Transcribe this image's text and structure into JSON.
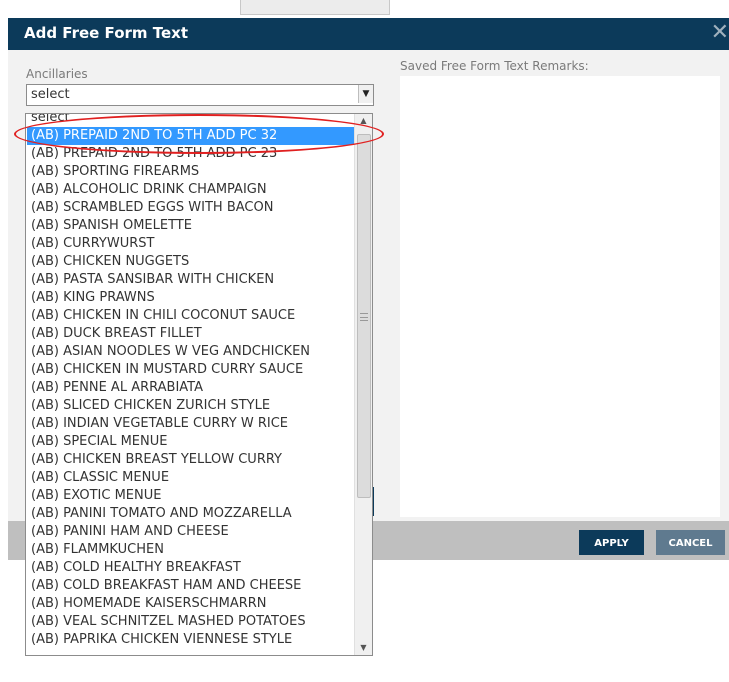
{
  "top_tab": "",
  "dialog": {
    "title": "Add Free Form Text",
    "close_glyph": "✕",
    "close_icon": "close-icon"
  },
  "ancillaries": {
    "label": "Ancillaries",
    "selected_value": "select",
    "arrow_icon": "dropdown-arrow-icon"
  },
  "saved": {
    "label": "Saved Free Form Text Remarks:"
  },
  "buttons": {
    "apply": "APPLY",
    "cancel": "CANCEL"
  },
  "dropdown": {
    "highlighted_index": 1,
    "options": [
      "select",
      "(AB) PREPAID 2ND TO 5TH ADD PC 32",
      "(AB) PREPAID 2ND TO 5TH ADD PC 23",
      "(AB) SPORTING FIREARMS",
      "(AB) ALCOHOLIC DRINK CHAMPAIGN",
      "(AB) SCRAMBLED EGGS WITH BACON",
      "(AB) SPANISH OMELETTE",
      "(AB) CURRYWURST",
      "(AB) CHICKEN NUGGETS",
      "(AB) PASTA SANSIBAR WITH CHICKEN",
      "(AB) KING PRAWNS",
      "(AB) CHICKEN IN CHILI COCONUT SAUCE",
      "(AB) DUCK BREAST FILLET",
      "(AB) ASIAN NOODLES W VEG ANDCHICKEN",
      "(AB) CHICKEN IN MUSTARD CURRY SAUCE",
      "(AB) PENNE AL ARRABIATA",
      "(AB) SLICED CHICKEN ZURICH STYLE",
      "(AB) INDIAN VEGETABLE CURRY W RICE",
      "(AB) SPECIAL MENUE",
      "(AB) CHICKEN BREAST YELLOW CURRY",
      "(AB) CLASSIC MENUE",
      "(AB) EXOTIC MENUE",
      "(AB) PANINI TOMATO AND MOZZARELLA",
      "(AB) PANINI HAM AND CHEESE",
      "(AB) FLAMMKUCHEN",
      "(AB) COLD HEALTHY BREAKFAST",
      "(AB) COLD BREAKFAST HAM AND CHEESE",
      "(AB) HOMEMADE KAISERSCHMARRN",
      "(AB) VEAL SCHNITZEL MASHED POTATOES",
      "(AB) PAPRIKA CHICKEN VIENNESE STYLE"
    ],
    "scroll_up_glyph": "▲",
    "scroll_down_glyph": "▼"
  },
  "colors": {
    "header_bg": "#0c3a5a",
    "highlight": "#3399ff",
    "annotation": "#e02020",
    "cancel_bg": "#5f7a8f"
  }
}
